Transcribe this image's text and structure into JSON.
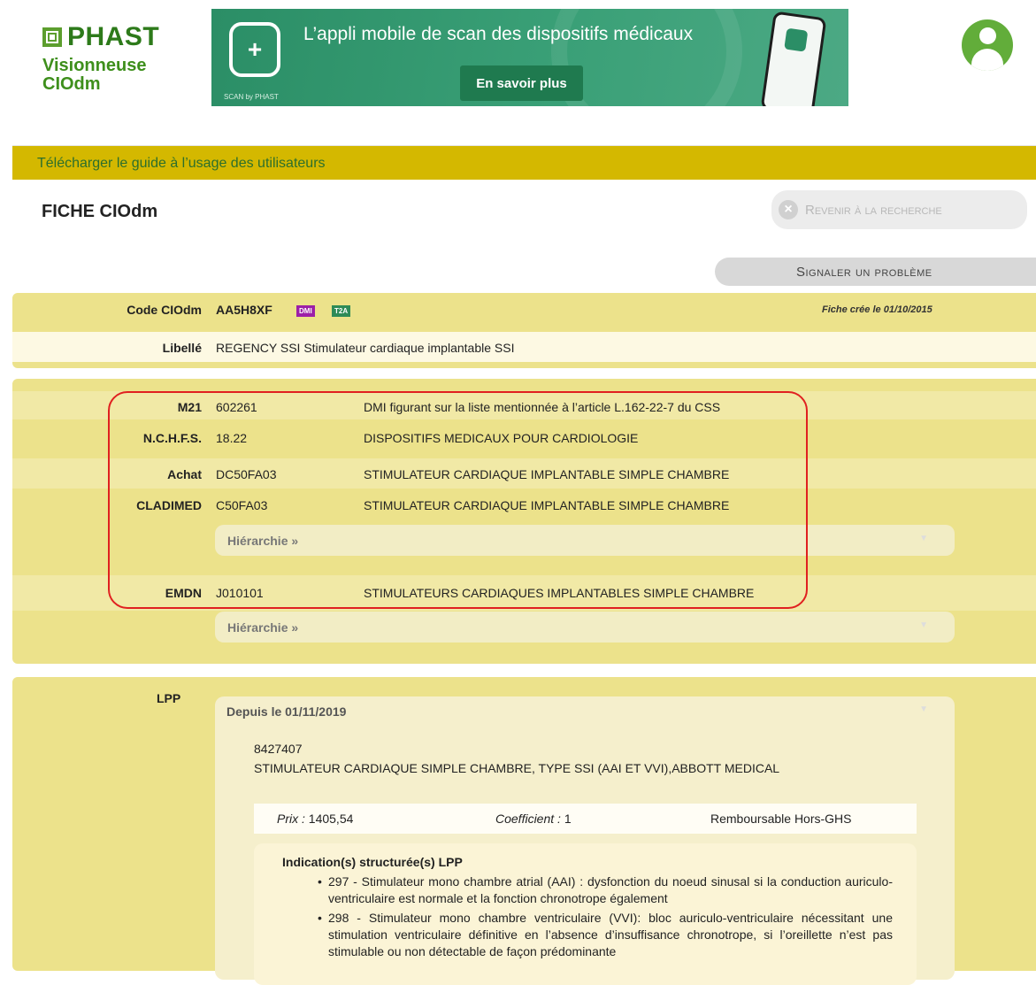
{
  "logo": {
    "text": "PHAST",
    "app_name_line1": "Visionneuse",
    "app_name_line2": "CIOdm"
  },
  "banner": {
    "headline": "L’appli mobile de scan des dispositifs médicaux",
    "button_label": "En savoir plus",
    "subtitle": "SCAN by PHAST",
    "icon_glyph": "+"
  },
  "guide_link": "Télécharger le guide à l’usage des utilisateurs",
  "page_title": "FICHE CIOdm",
  "back_button": {
    "icon": "close-icon",
    "label": "Revenir à la recherche"
  },
  "signal_button": "Signaler un problème",
  "identity": {
    "code_label": "Code CIOdm",
    "code_value": "AA5H8XF",
    "badge_dmi": "DMI",
    "badge_t2a": "T2A",
    "fiche_date": "Fiche crée le 01/10/2015",
    "libelle_label": "Libellé",
    "libelle_value": "REGENCY SSI Stimulateur cardiaque implantable SSI"
  },
  "classifications": [
    {
      "label": "M21",
      "code": "602261",
      "description": "DMI figurant sur la liste mentionnée à l’article L.162-22-7 du CSS"
    },
    {
      "label": "N.C.H.F.S.",
      "code": "18.22",
      "description": "DISPOSITIFS MEDICAUX POUR CARDIOLOGIE"
    },
    {
      "label": "Achat",
      "code": "DC50FA03",
      "description": "STIMULATEUR CARDIAQUE IMPLANTABLE SIMPLE CHAMBRE"
    },
    {
      "label": "CLADIMED",
      "code": "C50FA03",
      "description": "STIMULATEUR CARDIAQUE IMPLANTABLE SIMPLE CHAMBRE"
    },
    {
      "label": "EMDN",
      "code": "J010101",
      "description": "STIMULATEURS CARDIAQUES IMPLANTABLES SIMPLE CHAMBRE"
    }
  ],
  "hierarchy_label": "Hiérarchie »",
  "hierarchy_chevron": "▼",
  "lpp": {
    "label": "LPP",
    "since": "Depuis le 01/11/2019",
    "code": "8427407",
    "description": "STIMULATEUR CARDIAQUE SIMPLE CHAMBRE, TYPE SSI (AAI ET VVI),ABBOTT MEDICAL",
    "price_label": "Prix :",
    "price_value": " 1405,54",
    "coef_label": "Coefficient :",
    "coef_value": " 1",
    "reimbursement": "Remboursable Hors-GHS",
    "indications_title": "Indication(s) structurée(s) LPP",
    "indications": [
      "297 - Stimulateur mono chambre atrial (AAI) : dysfonction du noeud sinusal si la conduction auriculo-ventriculaire est normale et la fonction chronotrope également",
      "298 - Stimulateur mono chambre ventriculaire (VVI): bloc auriculo-ventriculaire nécessitant une stimulation ventriculaire définitive en l’absence d’insuffisance chronotrope, si l’oreillette n’est pas stimulable ou non détectable de façon prédominante"
    ]
  }
}
